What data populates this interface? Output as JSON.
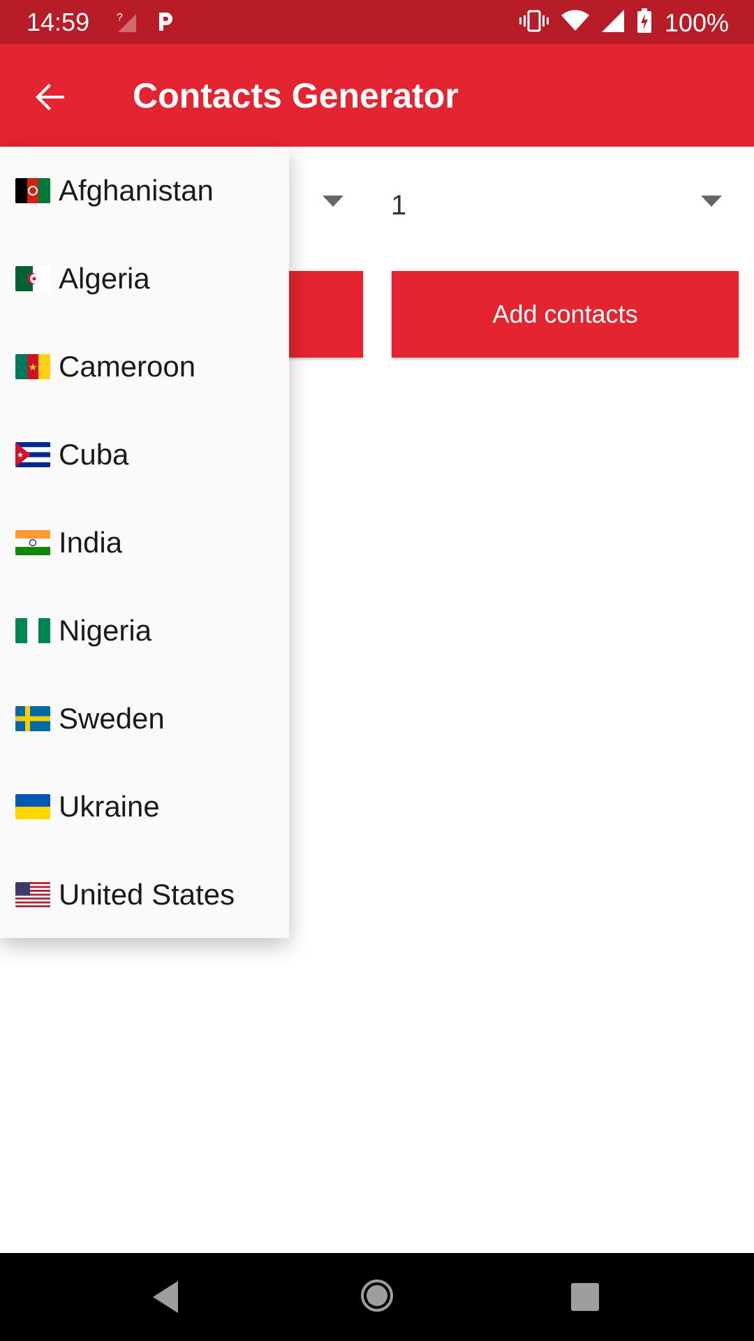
{
  "status_bar": {
    "time": "14:59",
    "battery": "100%"
  },
  "app_bar": {
    "title": "Contacts Generator"
  },
  "main": {
    "count_spinner_value": "1",
    "add_button_label": "Add contacts"
  },
  "dropdown": {
    "items": [
      {
        "label": "Afghanistan"
      },
      {
        "label": "Algeria"
      },
      {
        "label": "Cameroon"
      },
      {
        "label": "Cuba"
      },
      {
        "label": "India"
      },
      {
        "label": "Nigeria"
      },
      {
        "label": "Sweden"
      },
      {
        "label": "Ukraine"
      },
      {
        "label": "United States"
      }
    ]
  },
  "colors": {
    "status_bar": "#b71c27",
    "primary": "#e52431",
    "dropdown_bg": "#fafafa"
  }
}
